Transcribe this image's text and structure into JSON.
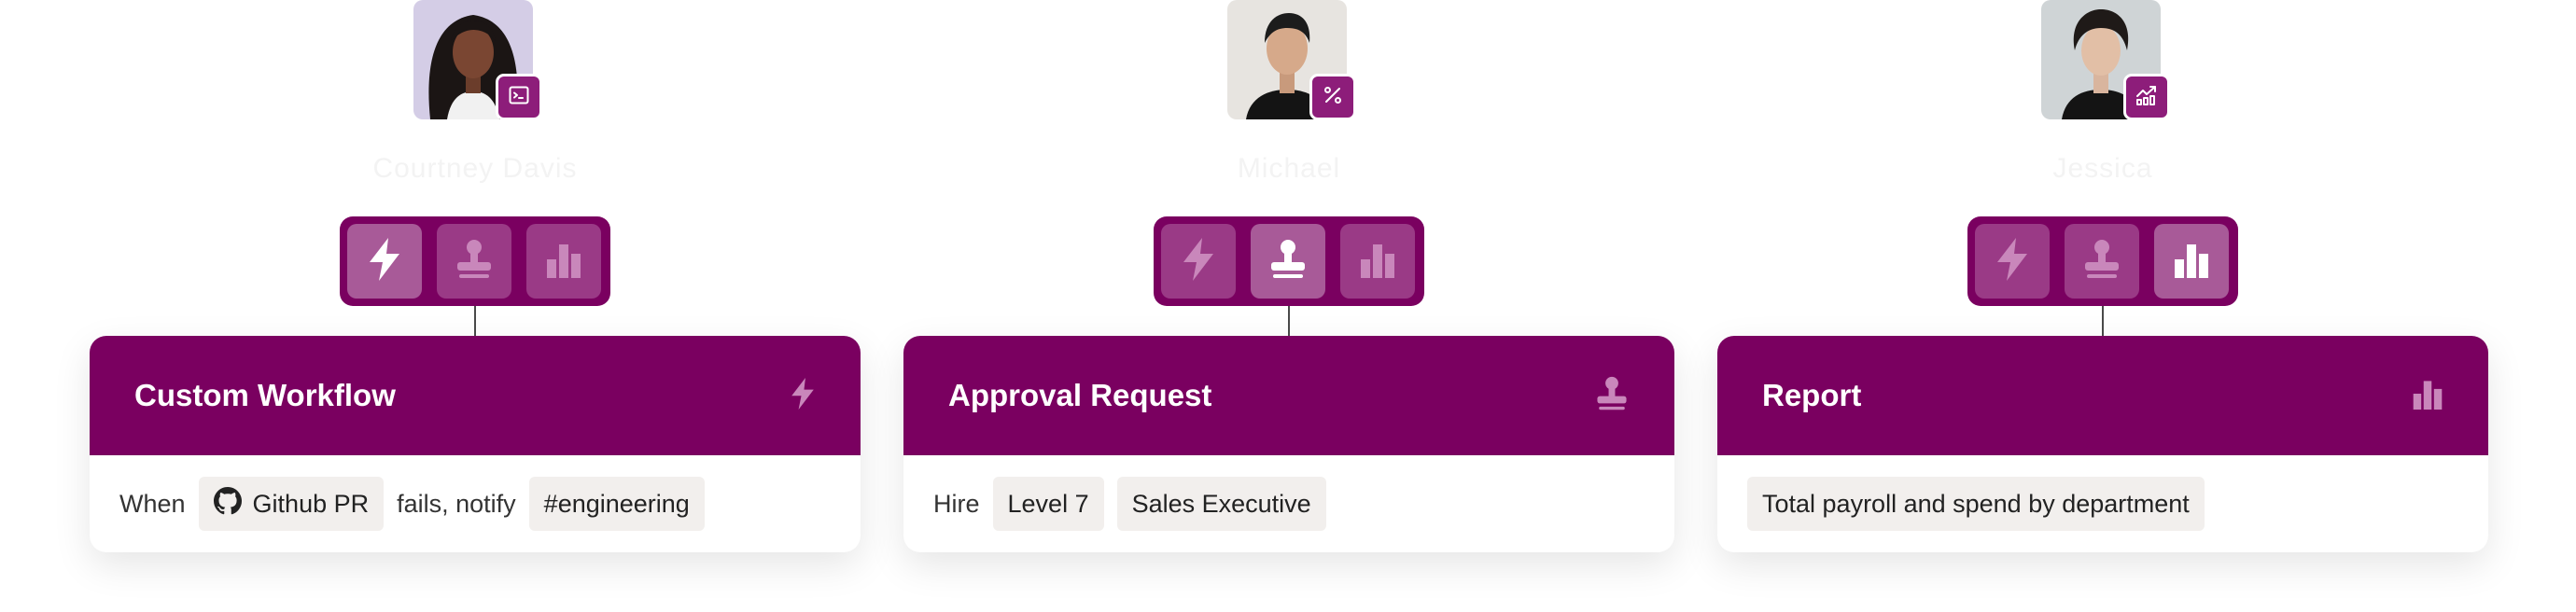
{
  "colors": {
    "brand": "#7a0060",
    "toggle_button": "#9a3a86",
    "toggle_button_active": "#a85a98",
    "badge": "#8d1d7a",
    "chip_bg": "#f2efed"
  },
  "columns": [
    {
      "person": {
        "name": "Courtney Davis",
        "badge_icon": "terminal-icon"
      },
      "toggle": {
        "active": "workflow",
        "buttons": [
          "lightning-icon",
          "stamp-icon",
          "bar-chart-icon"
        ]
      },
      "card": {
        "title": "Custom Workflow",
        "header_icon": "lightning-icon",
        "body": {
          "text1": "When",
          "chip1": "Github PR",
          "chip1_icon": "github-icon",
          "text2": "fails, notify",
          "chip2": "#engineering"
        }
      }
    },
    {
      "person": {
        "name": "Michael",
        "badge_icon": "percent-icon"
      },
      "toggle": {
        "active": "approval",
        "buttons": [
          "lightning-icon",
          "stamp-icon",
          "bar-chart-icon"
        ]
      },
      "card": {
        "title": "Approval Request",
        "header_icon": "stamp-icon",
        "body": {
          "text1": "Hire",
          "chip1": "Level 7",
          "chip2": "Sales Executive"
        }
      }
    },
    {
      "person": {
        "name": "Jessica",
        "badge_icon": "trending-chart-icon"
      },
      "toggle": {
        "active": "report",
        "buttons": [
          "lightning-icon",
          "stamp-icon",
          "bar-chart-icon"
        ]
      },
      "card": {
        "title": "Report",
        "header_icon": "bar-chart-icon",
        "body": {
          "chip1": "Total payroll and spend by department"
        }
      }
    }
  ]
}
